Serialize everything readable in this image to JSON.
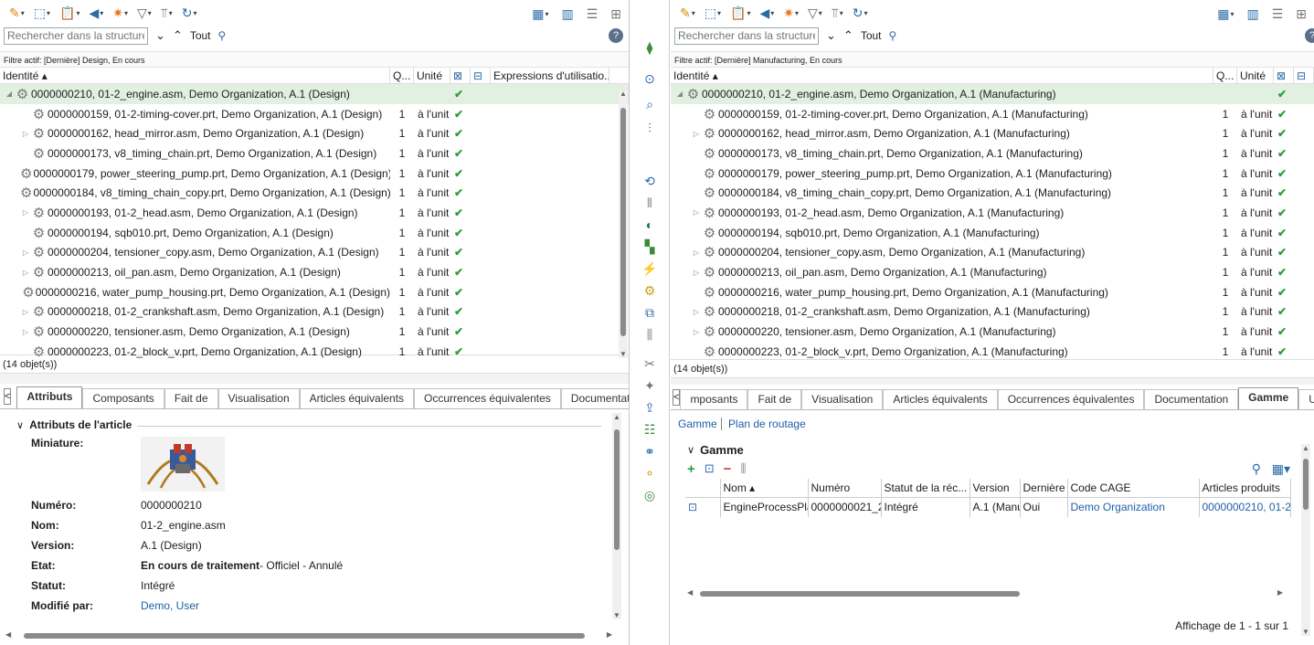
{
  "left": {
    "search_placeholder": "Rechercher dans la structure",
    "tout": "Tout",
    "filter": "Filtre actif: [Dernière] Design, En cours",
    "headers": {
      "identite": "Identité ▴",
      "q": "Q...",
      "unite": "Unité",
      "expr": "Expressions d'utilisatio..."
    },
    "rows": [
      {
        "name": "0000000210, 01-2_engine.asm, Demo Organization, A.1 (Design)",
        "qty": "",
        "unit": "",
        "twisty": "◢"
      },
      {
        "name": "0000000159, 01-2-timing-cover.prt, Demo Organization, A.1 (Design)",
        "qty": "1",
        "unit": "à l'unit",
        "twisty": ""
      },
      {
        "name": "0000000162, head_mirror.asm, Demo Organization, A.1 (Design)",
        "qty": "1",
        "unit": "à l'unit",
        "twisty": "▷"
      },
      {
        "name": "0000000173, v8_timing_chain.prt, Demo Organization, A.1 (Design)",
        "qty": "1",
        "unit": "à l'unit",
        "twisty": ""
      },
      {
        "name": "0000000179, power_steering_pump.prt, Demo Organization, A.1 (Design)",
        "qty": "1",
        "unit": "à l'unit",
        "twisty": ""
      },
      {
        "name": "0000000184, v8_timing_chain_copy.prt, Demo Organization, A.1 (Design)",
        "qty": "1",
        "unit": "à l'unit",
        "twisty": ""
      },
      {
        "name": "0000000193, 01-2_head.asm, Demo Organization, A.1 (Design)",
        "qty": "1",
        "unit": "à l'unit",
        "twisty": "▷"
      },
      {
        "name": "0000000194, sqb010.prt, Demo Organization, A.1 (Design)",
        "qty": "1",
        "unit": "à l'unit",
        "twisty": ""
      },
      {
        "name": "0000000204, tensioner_copy.asm, Demo Organization, A.1 (Design)",
        "qty": "1",
        "unit": "à l'unit",
        "twisty": "▷"
      },
      {
        "name": "0000000213, oil_pan.asm, Demo Organization, A.1 (Design)",
        "qty": "1",
        "unit": "à l'unit",
        "twisty": "▷"
      },
      {
        "name": "0000000216, water_pump_housing.prt, Demo Organization, A.1 (Design)",
        "qty": "1",
        "unit": "à l'unit",
        "twisty": ""
      },
      {
        "name": "0000000218, 01-2_crankshaft.asm, Demo Organization, A.1 (Design)",
        "qty": "1",
        "unit": "à l'unit",
        "twisty": "▷"
      },
      {
        "name": "0000000220, tensioner.asm, Demo Organization, A.1 (Design)",
        "qty": "1",
        "unit": "à l'unit",
        "twisty": "▷"
      },
      {
        "name": "0000000223, 01-2_block_v.prt, Demo Organization, A.1 (Design)",
        "qty": "1",
        "unit": "à l'unit",
        "twisty": ""
      }
    ],
    "status": "(14 objet(s))",
    "tabs": [
      "Attributs",
      "Composants",
      "Fait de",
      "Visualisation",
      "Articles équivalents",
      "Occurrences équivalentes",
      "Documentation"
    ],
    "section": "Attributs de l'article",
    "attrs": {
      "miniature_k": "Miniature:",
      "numero_k": "Numéro:",
      "numero_v": "0000000210",
      "nom_k": "Nom:",
      "nom_v": "01-2_engine.asm",
      "version_k": "Version:",
      "version_v": "A.1 (Design)",
      "etat_k": "Etat:",
      "etat_v": "En cours de traitement",
      "etat_rest": " - Officiel - Annulé",
      "statut_k": "Statut:",
      "statut_v": "Intégré",
      "modifie_k": "Modifié par:",
      "modifie_v": "Demo, User"
    }
  },
  "right": {
    "search_placeholder": "Rechercher dans la structure",
    "tout": "Tout",
    "filter": "Filtre actif: [Dernière] Manufacturing, En cours",
    "headers": {
      "identite": "Identité ▴",
      "q": "Q...",
      "unite": "Unité"
    },
    "rows": [
      {
        "name": "0000000210, 01-2_engine.asm, Demo Organization, A.1 (Manufacturing)",
        "qty": "",
        "unit": "",
        "twisty": "◢"
      },
      {
        "name": "0000000159, 01-2-timing-cover.prt, Demo Organization, A.1 (Manufacturing)",
        "qty": "1",
        "unit": "à l'unit",
        "twisty": ""
      },
      {
        "name": "0000000162, head_mirror.asm, Demo Organization, A.1 (Manufacturing)",
        "qty": "1",
        "unit": "à l'unit",
        "twisty": "▷"
      },
      {
        "name": "0000000173, v8_timing_chain.prt, Demo Organization, A.1 (Manufacturing)",
        "qty": "1",
        "unit": "à l'unit",
        "twisty": ""
      },
      {
        "name": "0000000179, power_steering_pump.prt, Demo Organization, A.1 (Manufacturing)",
        "qty": "1",
        "unit": "à l'unit",
        "twisty": ""
      },
      {
        "name": "0000000184, v8_timing_chain_copy.prt, Demo Organization, A.1 (Manufacturing)",
        "qty": "1",
        "unit": "à l'unit",
        "twisty": ""
      },
      {
        "name": "0000000193, 01-2_head.asm, Demo Organization, A.1 (Manufacturing)",
        "qty": "1",
        "unit": "à l'unit",
        "twisty": "▷"
      },
      {
        "name": "0000000194, sqb010.prt, Demo Organization, A.1 (Manufacturing)",
        "qty": "1",
        "unit": "à l'unit",
        "twisty": ""
      },
      {
        "name": "0000000204, tensioner_copy.asm, Demo Organization, A.1 (Manufacturing)",
        "qty": "1",
        "unit": "à l'unit",
        "twisty": "▷"
      },
      {
        "name": "0000000213, oil_pan.asm, Demo Organization, A.1 (Manufacturing)",
        "qty": "1",
        "unit": "à l'unit",
        "twisty": "▷"
      },
      {
        "name": "0000000216, water_pump_housing.prt, Demo Organization, A.1 (Manufacturing)",
        "qty": "1",
        "unit": "à l'unit",
        "twisty": ""
      },
      {
        "name": "0000000218, 01-2_crankshaft.asm, Demo Organization, A.1 (Manufacturing)",
        "qty": "1",
        "unit": "à l'unit",
        "twisty": "▷"
      },
      {
        "name": "0000000220, tensioner.asm, Demo Organization, A.1 (Manufacturing)",
        "qty": "1",
        "unit": "à l'unit",
        "twisty": "▷"
      },
      {
        "name": "0000000223, 01-2_block_v.prt, Demo Organization, A.1 (Manufacturing)",
        "qty": "1",
        "unit": "à l'unit",
        "twisty": ""
      }
    ],
    "status": "(14 objet(s))",
    "tabs": [
      "mposants",
      "Fait de",
      "Visualisation",
      "Articles équivalents",
      "Occurrences équivalentes",
      "Documentation",
      "Gamme",
      "Usines"
    ],
    "sublinks": [
      "Gamme",
      "Plan de routage"
    ],
    "section": "Gamme",
    "grid_headers": [
      "Nom ▴",
      "Numéro",
      "Statut de la réc...",
      "Version",
      "Dernière",
      "Code CAGE",
      "Articles produits"
    ],
    "grid_row": [
      "EngineProcessPlar",
      "0000000021_2",
      "Intégré",
      "A.1 (Manu",
      "Oui",
      "Demo Organization",
      "0000000210, 01-2_e"
    ],
    "footer": "Affichage de 1 - 1 sur 1"
  },
  "colors": {
    "selected_row": "#e2f0e2",
    "check": "#2e9e3a",
    "link": "#1f5fa8"
  }
}
